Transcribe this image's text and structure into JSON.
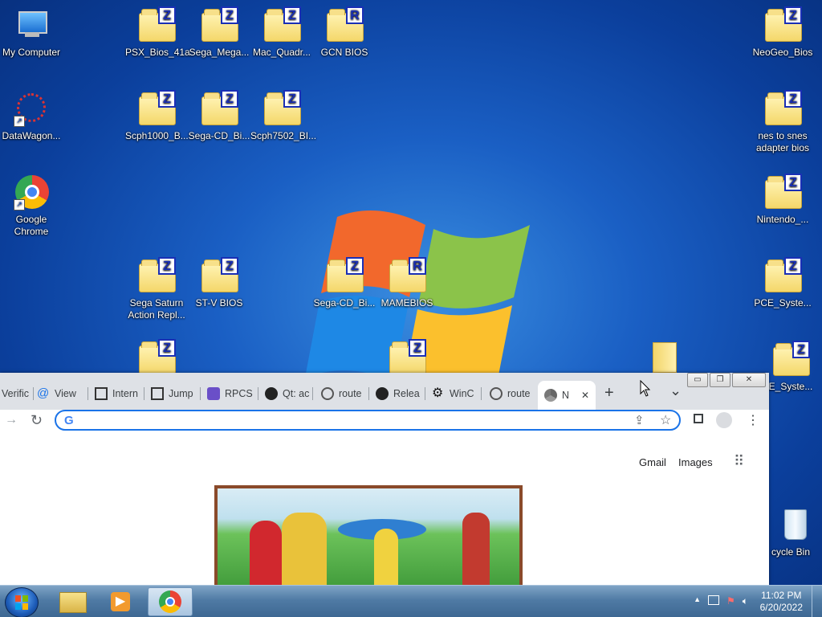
{
  "desktop": {
    "icons": [
      {
        "label": "My Computer",
        "type": "computer"
      },
      {
        "label": "DataWagon...",
        "type": "shortcut"
      },
      {
        "label": "Google Chrome",
        "type": "chrome"
      },
      {
        "label": "PSX_Bios_41a",
        "badge": "Z"
      },
      {
        "label": "Sega_Mega...",
        "badge": "Z"
      },
      {
        "label": "Mac_Quadr...",
        "badge": "Z"
      },
      {
        "label": "GCN BIOS",
        "badge": "R"
      },
      {
        "label": "Scph1000_B...",
        "badge": "Z"
      },
      {
        "label": "Sega-CD_Bi...",
        "badge": "Z"
      },
      {
        "label": "Scph7502_BI...",
        "badge": "Z"
      },
      {
        "label": "Sega Saturn Action Repl...",
        "badge": "Z"
      },
      {
        "label": "ST-V BIOS",
        "badge": "Z"
      },
      {
        "label": "Sega-CD_Bi...",
        "badge": "Z"
      },
      {
        "label": "MAMEBIOS",
        "badge": "R"
      },
      {
        "label": "",
        "badge": "Z"
      },
      {
        "label": "",
        "badge": "Z"
      },
      {
        "label": "NeoGeo_Bios",
        "badge": "Z"
      },
      {
        "label": "nes to snes adapter bios",
        "badge": "Z"
      },
      {
        "label": "Nintendo_...",
        "badge": "Z"
      },
      {
        "label": "PCE_Syste...",
        "badge": "Z"
      },
      {
        "label": "E_Syste...",
        "badge": "Z"
      },
      {
        "label": "cycle Bin",
        "type": "recycle"
      }
    ]
  },
  "chrome": {
    "tabs": [
      {
        "label": "Verific",
        "icon": "page-icon"
      },
      {
        "label": "View",
        "icon": "at-icon"
      },
      {
        "label": "Intern",
        "icon": "archive-icon"
      },
      {
        "label": "Jump",
        "icon": "archive-icon"
      },
      {
        "label": "RPCS",
        "icon": "rpcs-icon"
      },
      {
        "label": "Qt: ac",
        "icon": "github-icon"
      },
      {
        "label": "route",
        "icon": "globe-icon"
      },
      {
        "label": "Relea",
        "icon": "github-icon"
      },
      {
        "label": "WinC",
        "icon": "gear-icon"
      },
      {
        "label": "route",
        "icon": "globe-icon"
      },
      {
        "label": "N",
        "icon": "chrome-icon",
        "active": true
      }
    ],
    "new_tab_symbol": "+",
    "tab_list_symbol": "⌄",
    "close_symbol": "✕",
    "window_buttons": {
      "minimize": "▭",
      "maximize": "❐",
      "close": "✕"
    },
    "omnibox": {
      "value": "",
      "placeholder": ""
    },
    "links": {
      "gmail": "Gmail",
      "images": "Images"
    }
  },
  "taskbar": {
    "clock_time": "11:02 PM",
    "clock_date": "6/20/2022",
    "tray_arrow": "▲"
  },
  "colors": {
    "accent": "#1a73e8",
    "badge_blue": "#1a2fb5",
    "taskbar": "#4f7aa4"
  }
}
